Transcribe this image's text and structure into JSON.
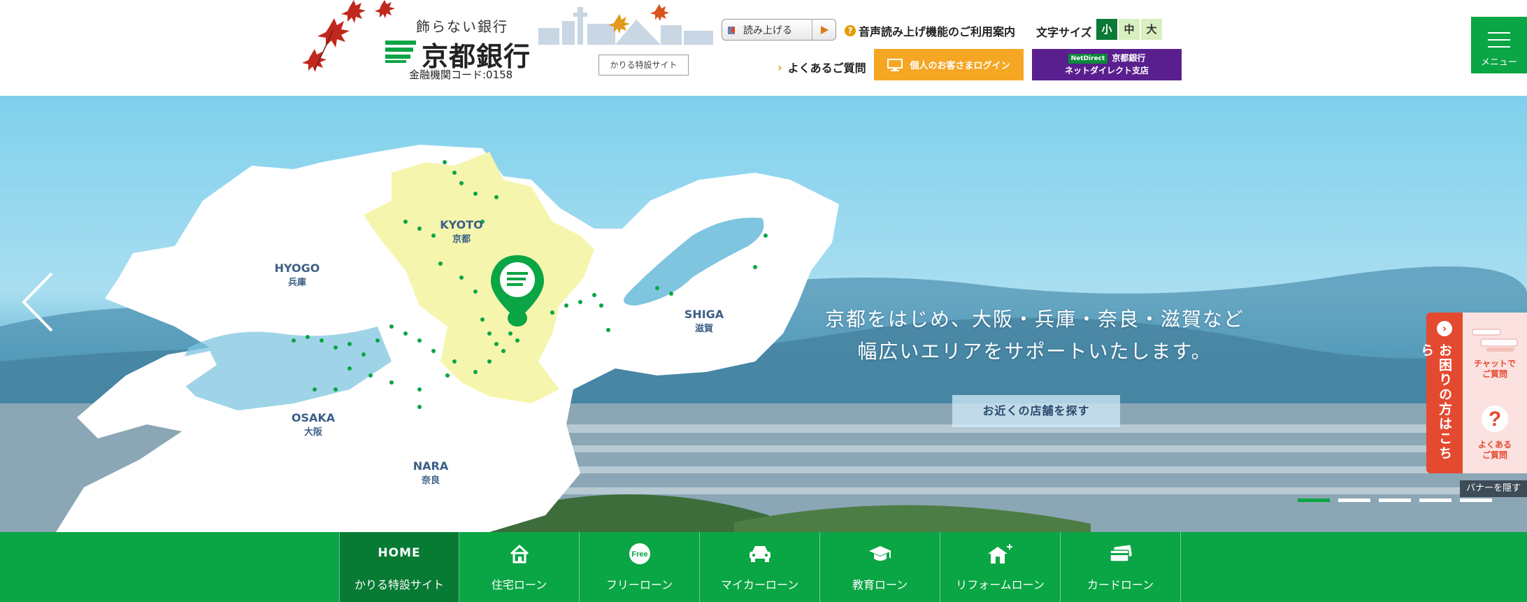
{
  "header": {
    "tagline": "飾らない銀行",
    "bank_name": "京都銀行",
    "bank_code": "金融機関コード:0158",
    "karir_site_link": "かりる特設サイト",
    "read_aloud_label": "読み上げる",
    "voice_guide_label": "音声読み上げ機能のご利用案内",
    "fontsize_label": "文字サイズ",
    "fontsize_small": "小",
    "fontsize_medium": "中",
    "fontsize_large": "大",
    "faq_link": "よくあるご質問",
    "login_button": "個人のお客さまログイン",
    "netdirect_badge": "NetDirect",
    "netdirect_line1": "京都銀行",
    "netdirect_line2": "ネットダイレクト支店",
    "menu_label": "メニュー"
  },
  "hero": {
    "headline_line1": "京都をはじめ、大阪・兵庫・奈良・滋賀など",
    "headline_line2": "幅広いエリアをサポートいたします。",
    "store_button": "お近くの店舗を探す",
    "regions": [
      {
        "en": "KYOTO",
        "ja": "京都"
      },
      {
        "en": "HYOGO",
        "ja": "兵庫"
      },
      {
        "en": "SHIGA",
        "ja": "滋賀"
      },
      {
        "en": "OSAKA",
        "ja": "大阪"
      },
      {
        "en": "NARA",
        "ja": "奈良"
      }
    ],
    "slide_count": 5,
    "active_slide": 1
  },
  "side_banner": {
    "tab_label": "お困りの方はこちら",
    "chat_label_1": "チャットで",
    "chat_label_2": "ご質問",
    "faq_label_1": "よくある",
    "faq_label_2": "ご質問",
    "hide_label": "バナーを隠す"
  },
  "nav": {
    "items": [
      {
        "top": "HOME",
        "label": "かりる特設サイト",
        "icon": "home-text"
      },
      {
        "label": "住宅ローン",
        "icon": "house-icon"
      },
      {
        "label": "フリーローン",
        "icon": "free-icon"
      },
      {
        "label": "マイカーローン",
        "icon": "car-icon"
      },
      {
        "label": "教育ローン",
        "icon": "graduation-cap-icon"
      },
      {
        "label": "リフォームローン",
        "icon": "house-plus-icon"
      },
      {
        "label": "カードローン",
        "icon": "card-icon"
      }
    ]
  },
  "colors": {
    "brand_green": "#0aa544",
    "dark_green": "#077a33",
    "orange": "#f5a623",
    "purple": "#5a1f8f",
    "help_red": "#e44a30"
  }
}
